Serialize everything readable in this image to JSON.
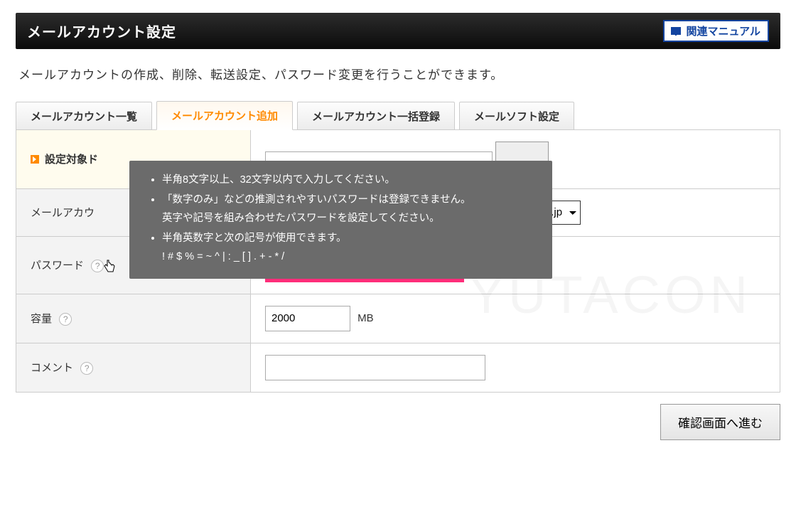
{
  "header": {
    "title": "メールアカウント設定",
    "related_manual": "関連マニュアル"
  },
  "description": "メールアカウントの作成、削除、転送設定、パスワード変更を行うことができます。",
  "tabs": {
    "list": "メールアカウント一覧",
    "add": "メールアカウント追加",
    "bulk": "メールアカウント一括登録",
    "mailsoft": "メールソフト設定"
  },
  "form": {
    "target_domain_label": "設定対象ド",
    "mail_account_label": "メールアカウ",
    "domain_choice": "eate.jp",
    "password_label": "パスワード",
    "quota_label": "容量",
    "quota_value": "2000",
    "quota_unit": "MB",
    "comment_label": "コメント"
  },
  "tooltip": {
    "line1": "半角8文字以上、32文字以内で入力してください。",
    "line2a": "「数字のみ」などの推測されやすいパスワードは登録できません。",
    "line2b": "英字や記号を組み合わせたパスワードを設定してください。",
    "line3a": "半角英数字と次の記号が使用できます。",
    "line3b": "! # $ % = ~ ^ | : _ [ ] . + - * /"
  },
  "watermark": "YUTACON",
  "confirm_button": "確認画面へ進む"
}
